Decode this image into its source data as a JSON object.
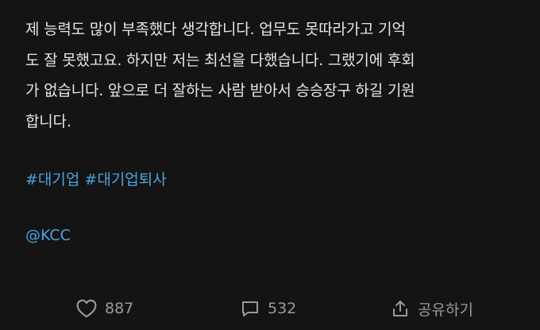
{
  "post": {
    "body_lines": [
      "제 능력도 많이 부족했다 생각합니다. 업무도 못따라가고 기억",
      "도 잘 못했고요. 하지만 저는 최선을 다했습니다. 그랬기에 후회",
      "가 없습니다. 앞으로 더 잘하는 사람 받아서 승승장구 하길 기원",
      "합니다."
    ],
    "hashtags": [
      "#대기업",
      "#대기업퇴사"
    ],
    "mention": "@KCC"
  },
  "actions": {
    "like": {
      "icon": "heart-icon",
      "count": "887"
    },
    "comment": {
      "icon": "comment-icon",
      "count": "532"
    },
    "share": {
      "icon": "share-icon",
      "label": "공유하기"
    }
  },
  "colors": {
    "background": "#141414",
    "text": "#e6e6e6",
    "link": "#4aa3df",
    "muted": "#9a9a9a"
  }
}
